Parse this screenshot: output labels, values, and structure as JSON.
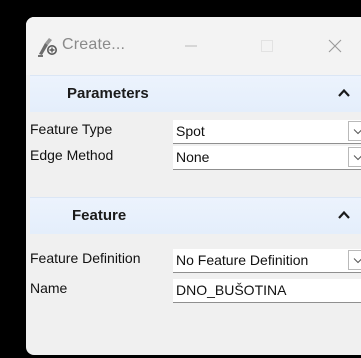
{
  "window": {
    "title": "Create...",
    "icon": "create-feature-icon"
  },
  "sections": {
    "parameters": {
      "title": "Parameters",
      "feature_type": {
        "label": "Feature Type",
        "value": "Spot"
      },
      "edge_method": {
        "label": "Edge Method",
        "value": "None"
      }
    },
    "feature": {
      "title": "Feature",
      "feature_definition": {
        "label": "Feature Definition",
        "value": "No Feature Definition"
      },
      "name": {
        "label": "Name",
        "value": "DNO_BUŠOTINA"
      }
    }
  },
  "colors": {
    "background": "#000000",
    "panel": "#f0f0f0",
    "section_header": "#e8f0fc"
  }
}
